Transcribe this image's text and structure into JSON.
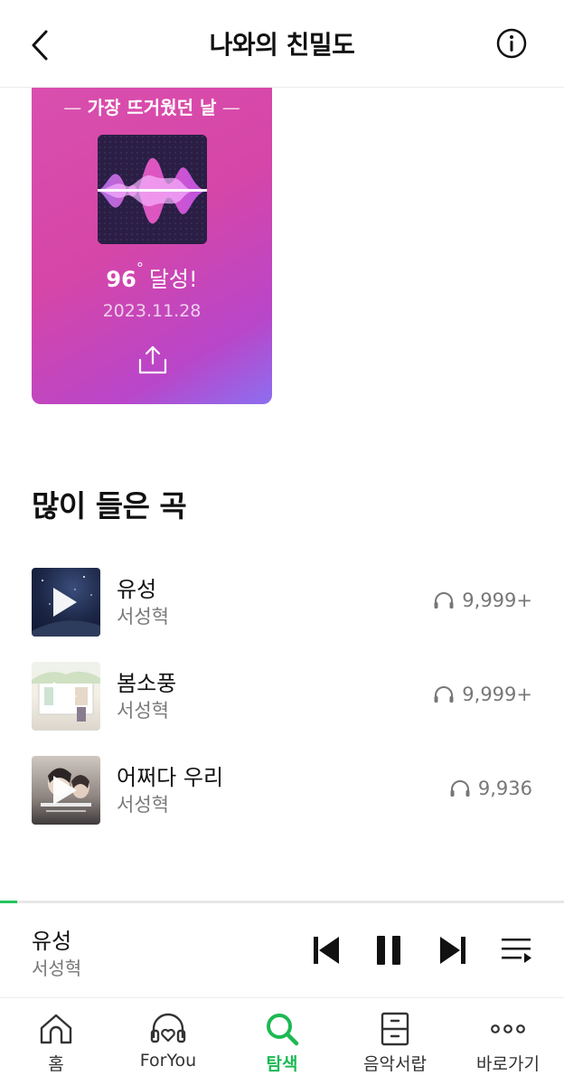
{
  "header": {
    "title": "나와의 친밀도"
  },
  "card": {
    "title": "가장 뜨거웠던 날",
    "score": "96",
    "degree": "°",
    "achieved": "달성!",
    "date": "2023.11.28"
  },
  "section": {
    "title": "많이 들은 곡"
  },
  "tracks": [
    {
      "title": "유성",
      "artist": "서성혁",
      "plays": "9,999+"
    },
    {
      "title": "봄소풍",
      "artist": "서성혁",
      "plays": "9,999+"
    },
    {
      "title": "어쩌다 우리",
      "artist": "서성혁",
      "plays": "9,936"
    }
  ],
  "player": {
    "title": "유성",
    "artist": "서성혁",
    "progress": 0.03
  },
  "nav": {
    "items": [
      {
        "label": "홈",
        "icon": "home-icon"
      },
      {
        "label": "ForYou",
        "icon": "headphones-heart-icon"
      },
      {
        "label": "탐색",
        "icon": "search-icon",
        "active": true
      },
      {
        "label": "음악서랍",
        "icon": "drawer-icon"
      },
      {
        "label": "바로가기",
        "icon": "more-dots-icon"
      }
    ]
  },
  "colors": {
    "accent": "#1db954",
    "card_pink": "#d946a8",
    "card_purple": "#8d6ef0"
  }
}
